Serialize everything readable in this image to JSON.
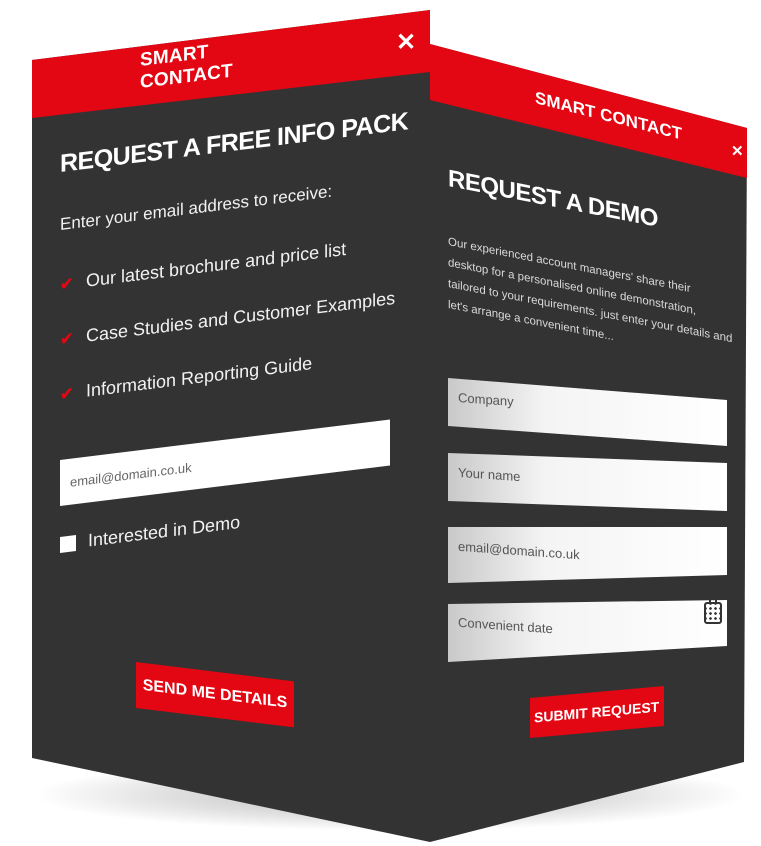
{
  "left_panel": {
    "header_title": "SMART CONTACT",
    "close_symbol": "✕",
    "heading": "REQUEST A FREE INFO PACK",
    "intro": "Enter your email address to receive:",
    "benefits": [
      "Our latest brochure and price list",
      "Case Studies and Customer Examples",
      "Information Reporting Guide"
    ],
    "email_placeholder": "email@domain.co.uk",
    "checkbox_label": "Interested in Demo",
    "submit_label": "SEND ME DETAILS"
  },
  "right_panel": {
    "header_title": "SMART CONTACT",
    "close_symbol": "✕",
    "heading": "REQUEST A DEMO",
    "description": "Our experienced account managers' share their desktop for a personalised online demonstration, tailored to your requirements. just enter your details and let's arrange a convenient time...",
    "fields": {
      "company": "Company",
      "name": "Your name",
      "email": "email@domain.co.uk",
      "date": "Convenient date"
    },
    "submit_label": "SUBMIT REQUEST"
  },
  "icons": {
    "check": "check-icon",
    "close": "close-icon",
    "calendar": "calendar-icon"
  },
  "colors": {
    "accent_red": "#e30613",
    "panel_dark": "#333333",
    "field_white": "#ffffff"
  }
}
